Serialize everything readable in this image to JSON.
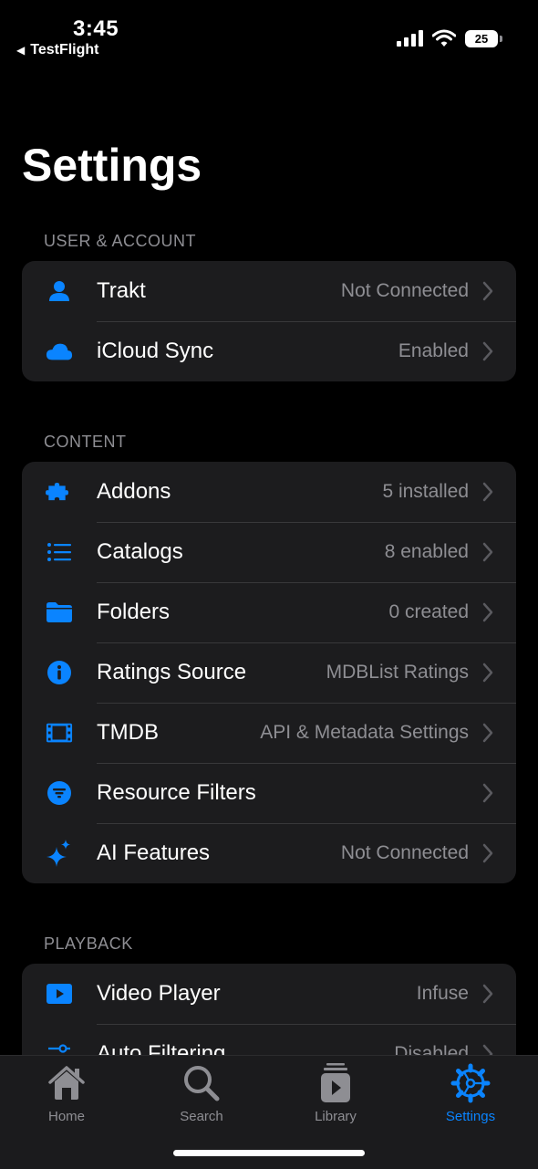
{
  "status_bar": {
    "time": "3:45",
    "back_app": "TestFlight",
    "battery": "25"
  },
  "page": {
    "title": "Settings"
  },
  "sections": {
    "user_account": {
      "header": "USER & ACCOUNT",
      "rows": [
        {
          "label": "Trakt",
          "value": "Not Connected",
          "icon": "person-icon"
        },
        {
          "label": "iCloud Sync",
          "value": "Enabled",
          "icon": "cloud-icon"
        }
      ]
    },
    "content": {
      "header": "CONTENT",
      "rows": [
        {
          "label": "Addons",
          "value": "5 installed",
          "icon": "puzzle-icon"
        },
        {
          "label": "Catalogs",
          "value": "8 enabled",
          "icon": "list-icon"
        },
        {
          "label": "Folders",
          "value": "0 created",
          "icon": "folder-icon"
        },
        {
          "label": "Ratings Source",
          "value": "MDBList Ratings",
          "icon": "info-icon"
        },
        {
          "label": "TMDB",
          "value": "API & Metadata Settings",
          "icon": "film-icon"
        },
        {
          "label": "Resource Filters",
          "value": "",
          "icon": "filter-icon"
        },
        {
          "label": "AI Features",
          "value": "Not Connected",
          "icon": "sparkles-icon"
        }
      ]
    },
    "playback": {
      "header": "PLAYBACK",
      "rows": [
        {
          "label": "Video Player",
          "value": "Infuse",
          "icon": "play-icon"
        },
        {
          "label": "Auto Filtering",
          "value": "Disabled",
          "icon": "sliders-icon"
        }
      ]
    }
  },
  "tab_bar": {
    "tabs": [
      {
        "label": "Home",
        "icon": "house-icon"
      },
      {
        "label": "Search",
        "icon": "magnifier-icon"
      },
      {
        "label": "Library",
        "icon": "library-icon"
      },
      {
        "label": "Settings",
        "icon": "gear-icon"
      }
    ],
    "active": "Settings"
  },
  "colors": {
    "accent": "#0a84ff",
    "background": "#000000",
    "group": "#1c1c1e",
    "secondary_text": "#8e8e93"
  }
}
